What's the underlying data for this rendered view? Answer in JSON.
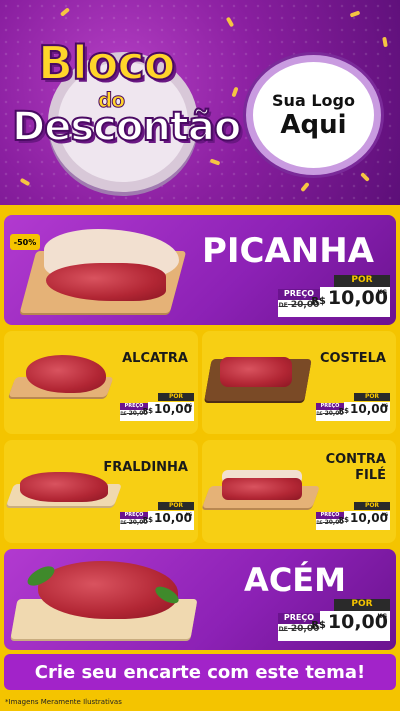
{
  "header": {
    "title_line1": "Bloco",
    "title_line2": "do",
    "title_line3": "Descontão",
    "logo_line1": "Sua Logo",
    "logo_line2": "Aqui"
  },
  "discount_badge": "-50%",
  "products": [
    {
      "name": "PICANHA",
      "por": "POR",
      "preco": "PREÇO",
      "de": "DE",
      "old_price": "20,00",
      "currency": "R$",
      "price": "10,00",
      "unit": "KG"
    },
    {
      "name": "ALCATRA",
      "por": "POR",
      "preco": "PREÇO",
      "de": "DE",
      "old_price": "20,00",
      "currency": "R$",
      "price": "10,00",
      "unit": "KG"
    },
    {
      "name": "COSTELA",
      "por": "POR",
      "preco": "PREÇO",
      "de": "DE",
      "old_price": "20,00",
      "currency": "R$",
      "price": "10,00",
      "unit": "KG"
    },
    {
      "name": "FRALDINHA",
      "por": "POR",
      "preco": "PREÇO",
      "de": "DE",
      "old_price": "20,00",
      "currency": "R$",
      "price": "10,00",
      "unit": "KG"
    },
    {
      "name_line1": "CONTRA",
      "name_line2": "FILÉ",
      "por": "POR",
      "preco": "PREÇO",
      "de": "DE",
      "old_price": "20,00",
      "currency": "R$",
      "price": "10,00",
      "unit": "KG"
    },
    {
      "name": "ACÉM",
      "por": "POR",
      "preco": "PREÇO",
      "de": "DE",
      "old_price": "20,00",
      "currency": "R$",
      "price": "10,00",
      "unit": "KG"
    }
  ],
  "cta": "Crie seu encarte com este tema!",
  "disclaimer": "*Imagens Meramente Ilustrativas",
  "colors": {
    "purple": "#8c21b5",
    "yellow": "#f5c400",
    "dark": "#2a2a2a"
  }
}
